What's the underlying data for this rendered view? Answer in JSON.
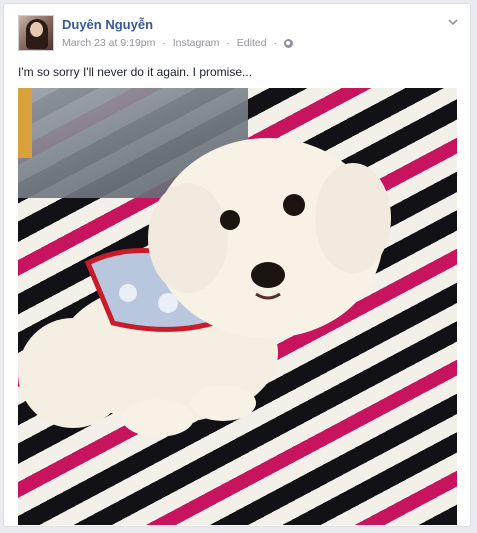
{
  "post": {
    "author": "Duyên Nguyễn",
    "time": "March 23 at 9:19pm",
    "source": "Instagram",
    "edited": "Edited",
    "privacy_icon": "globe-icon",
    "menu_icon": "chevron-down-icon",
    "message": "I'm so sorry I'll never do it again. I promise..."
  },
  "colors": {
    "author_link": "#365899",
    "meta_text": "#90949c",
    "background": "#e9ebee"
  }
}
